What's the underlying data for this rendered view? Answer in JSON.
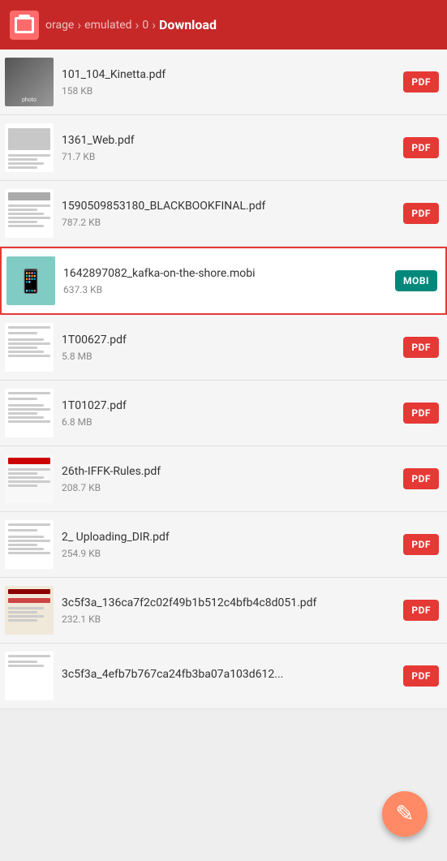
{
  "header": {
    "logo_label": "File Manager",
    "breadcrumb": [
      {
        "label": "orage",
        "active": false
      },
      {
        "label": "emulated",
        "active": false
      },
      {
        "label": "0",
        "active": false
      },
      {
        "label": "Download",
        "active": true
      }
    ]
  },
  "files": [
    {
      "id": 1,
      "name": "101_104_Kinetta.pdf",
      "size": "158 KB",
      "badge": "PDF",
      "badge_type": "pdf",
      "highlighted": false
    },
    {
      "id": 2,
      "name": "1361_Web.pdf",
      "size": "71.7 KB",
      "badge": "PDF",
      "badge_type": "pdf",
      "highlighted": false
    },
    {
      "id": 3,
      "name": "1590509853180_BLACKBOOKFINAL.pdf",
      "size": "787.2 KB",
      "badge": "PDF",
      "badge_type": "pdf",
      "highlighted": false
    },
    {
      "id": 4,
      "name": "1642897082_kafka-on-the-shore.mobi",
      "size": "637.3 KB",
      "badge": "MOBI",
      "badge_type": "mobi",
      "highlighted": true
    },
    {
      "id": 5,
      "name": "1T00627.pdf",
      "size": "5.8 MB",
      "badge": "PDF",
      "badge_type": "pdf",
      "highlighted": false
    },
    {
      "id": 6,
      "name": "1T01027.pdf",
      "size": "6.8 MB",
      "badge": "PDF",
      "badge_type": "pdf",
      "highlighted": false
    },
    {
      "id": 7,
      "name": "26th-IFFK-Rules.pdf",
      "size": "208.7 KB",
      "badge": "PDF",
      "badge_type": "pdf",
      "highlighted": false
    },
    {
      "id": 8,
      "name": "2_ Uploading_DIR.pdf",
      "size": "254.9 KB",
      "badge": "PDF",
      "badge_type": "pdf",
      "highlighted": false
    },
    {
      "id": 9,
      "name": "3c5f3a_136ca7f2c02f49b1b512c4bfb4c8d051.pdf",
      "size": "232.1 KB",
      "badge": "PDF",
      "badge_type": "pdf",
      "highlighted": false
    },
    {
      "id": 10,
      "name": "3c5f3a_4efb7b767ca24fb3ba07a103d612...",
      "size": "",
      "badge": "PDF",
      "badge_type": "pdf",
      "highlighted": false,
      "partial": true
    }
  ],
  "fab": {
    "icon": "✎",
    "label": "Edit"
  },
  "colors": {
    "header_bg": "#c62828",
    "pdf_badge": "#e53935",
    "mobi_badge": "#00897b",
    "highlight_border": "#e53935",
    "fab_bg": "#ff8a65",
    "mobi_thumb": "#80cbc4"
  }
}
